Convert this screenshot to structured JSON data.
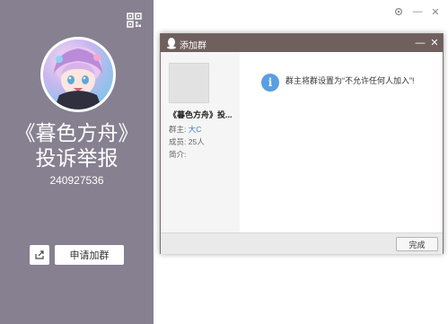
{
  "profile": {
    "group_name": "《暮色方舟》投诉举报",
    "group_id": "240927536",
    "apply_button": "申请加群",
    "share_icon": "share-export-icon",
    "qr_icon": "qr-code-icon",
    "background_color": "#868090"
  },
  "window": {
    "settings_icon": "gear-icon",
    "minimize_label": "—",
    "close_label": "✕"
  },
  "dialog": {
    "title": "添加群",
    "minimize_label": "—",
    "close_label": "✕",
    "titlebar_color": "#6f5f5d",
    "group_card": {
      "name": "《暮色方舟》投...",
      "owner_label": "群主:",
      "owner_value": "大C",
      "members_label": "成员:",
      "members_value": "25人",
      "intro_label": "简介:",
      "intro_value": ""
    },
    "notice": {
      "icon": "info-icon",
      "text": "群主将群设置为“不允许任何人加入”!"
    },
    "done_button": "完成"
  }
}
